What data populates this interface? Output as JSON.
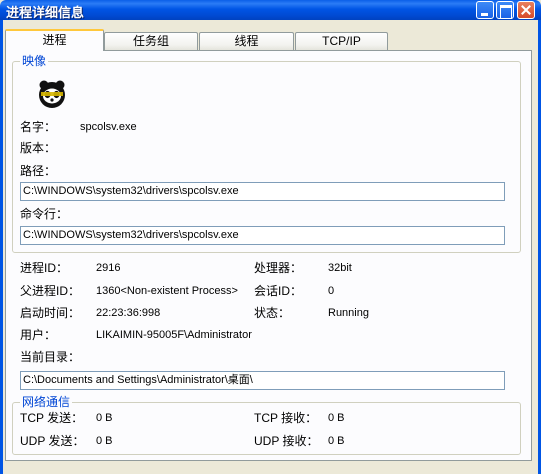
{
  "window": {
    "title": "进程详细信息"
  },
  "tabs": [
    {
      "label": "进程"
    },
    {
      "label": "任务组"
    },
    {
      "label": "线程"
    },
    {
      "label": "TCP/IP"
    }
  ],
  "image_group": {
    "title": "映像",
    "icon": "panda-icon",
    "name_label": "名字：",
    "name_value": "spcolsv.exe",
    "version_label": "版本：",
    "version_value": "",
    "path_label": "路径：",
    "path_value": "C:\\WINDOWS\\system32\\drivers\\spcolsv.exe",
    "cmdline_label": "命令行：",
    "cmdline_value": "C:\\WINDOWS\\system32\\drivers\\spcolsv.exe"
  },
  "process_info": {
    "pid_label": "进程ID：",
    "pid_value": "2916",
    "cpu_label": "处理器：",
    "cpu_value": "32bit",
    "ppid_label": "父进程ID：",
    "ppid_value": "1360<Non-existent Process>",
    "session_label": "会话ID：",
    "session_value": "0",
    "start_label": "启动时间：",
    "start_value": "22:23:36:998",
    "state_label": "状态：",
    "state_value": "Running",
    "user_label": "用户：",
    "user_value": "LIKAIMIN-95005F\\Administrator",
    "cwd_label": "当前目录：",
    "cwd_value": "C:\\Documents and Settings\\Administrator\\桌面\\"
  },
  "network_group": {
    "title": "网络通信",
    "tcp_send_label": "TCP 发送：",
    "tcp_send_value": "0 B",
    "tcp_recv_label": "TCP 接收：",
    "tcp_recv_value": "0 B",
    "udp_send_label": "UDP 发送：",
    "udp_send_value": "0 B",
    "udp_recv_label": "UDP 接收：",
    "udp_recv_value": "0 B"
  },
  "colors": {
    "titlebar": "#0055E5",
    "group_title": "#0046D5",
    "active_tab_accent": "#FFC83C"
  }
}
